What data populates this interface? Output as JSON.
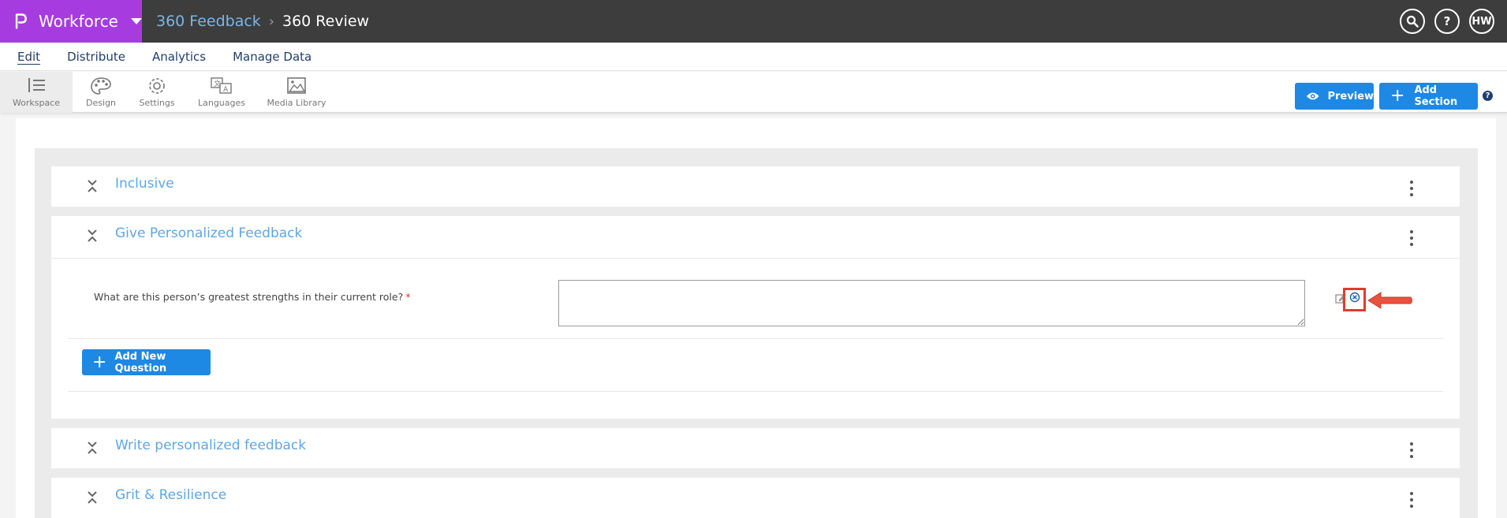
{
  "app": {
    "product_name": "Workforce",
    "breadcrumb": {
      "parent": "360 Feedback",
      "current": "360 Review"
    },
    "user_initials": "HW"
  },
  "nav": {
    "tabs": [
      "Edit",
      "Distribute",
      "Analytics",
      "Manage Data"
    ],
    "active": "Edit"
  },
  "toolbar": {
    "tools": [
      "Workspace",
      "Design",
      "Settings",
      "Languages",
      "Media Library"
    ],
    "preview_label": "Preview",
    "add_section_label": "Add Section"
  },
  "sections": [
    {
      "title": "Inclusive"
    },
    {
      "title": "Give Personalized Feedback",
      "question": {
        "text": "What are this person’s greatest strengths in their current role?",
        "required_marker": "*"
      },
      "add_question_label": "Add New Question"
    },
    {
      "title": "Write personalized feedback"
    },
    {
      "title": "Grit & Resilience"
    }
  ],
  "colors": {
    "brand_purple": "#a63ce0",
    "topbar": "#3d3d3d",
    "accent_blue": "#1e88e5",
    "section_title": "#5ea6e3",
    "highlight_red": "#e23a2e"
  }
}
